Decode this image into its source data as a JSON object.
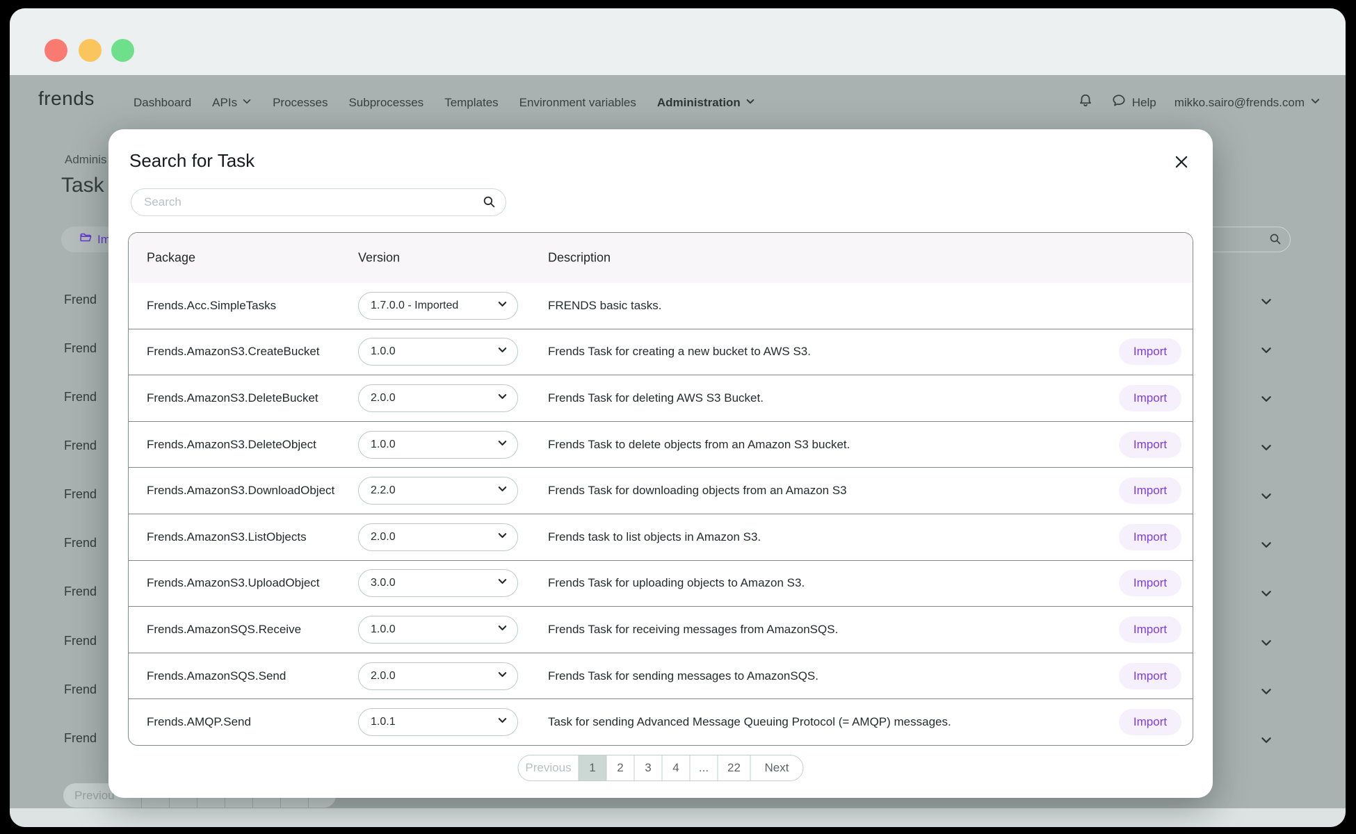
{
  "titlebar": {
    "traffic_lights": {
      "red": "#f97a70",
      "yellow": "#fbc55e",
      "green": "#6edf8a"
    }
  },
  "navbar": {
    "logo": "frends",
    "items": [
      "Dashboard",
      "APIs",
      "Processes",
      "Subprocesses",
      "Templates",
      "Environment variables",
      "Administration"
    ],
    "help": "Help",
    "email": "mikko.sairo@frends.com"
  },
  "background": {
    "breadcrumb": "Adminis",
    "heading": "Task",
    "import_task_button": "Im",
    "rows": [
      "Frend",
      "Frend",
      "Frend",
      "Frend",
      "Frend",
      "Frend",
      "Frend",
      "Frend",
      "Frend",
      "Frend"
    ],
    "pagination_previous": "Previou"
  },
  "modal": {
    "title": "Search for Task",
    "search_placeholder": "Search",
    "table": {
      "col_package": "Package",
      "col_version": "Version",
      "col_description": "Description",
      "rows": [
        {
          "package": "Frends.Acc.SimpleTasks",
          "version": "1.7.0.0 - Imported",
          "description": "FRENDS basic tasks."
        },
        {
          "package": "Frends.AmazonS3.CreateBucket",
          "version": "1.0.0",
          "description": "Frends Task for creating a new bucket to AWS S3.",
          "import": "Import"
        },
        {
          "package": "Frends.AmazonS3.DeleteBucket",
          "version": "2.0.0",
          "description": "Frends Task for deleting AWS S3 Bucket.",
          "import": "Import"
        },
        {
          "package": "Frends.AmazonS3.DeleteObject",
          "version": "1.0.0",
          "description": "Frends Task to delete objects from an Amazon S3 bucket.",
          "import": "Import"
        },
        {
          "package": "Frends.AmazonS3.DownloadObject",
          "version": "2.2.0",
          "description": "Frends Task for downloading objects from an Amazon S3",
          "import": "Import"
        },
        {
          "package": "Frends.AmazonS3.ListObjects",
          "version": "2.0.0",
          "description": "Frends task to list objects in Amazon S3.",
          "import": "Import"
        },
        {
          "package": "Frends.AmazonS3.UploadObject",
          "version": "3.0.0",
          "description": "Frends Task for uploading objects to Amazon S3.",
          "import": "Import"
        },
        {
          "package": "Frends.AmazonSQS.Receive",
          "version": "1.0.0",
          "description": "Frends Task for receiving messages from AmazonSQS.",
          "import": "Import"
        },
        {
          "package": "Frends.AmazonSQS.Send",
          "version": "2.0.0",
          "description": "Frends Task for sending messages to AmazonSQS.",
          "import": "Import"
        },
        {
          "package": "Frends.AMQP.Send",
          "version": "1.0.1",
          "description": "Task for sending Advanced Message Queuing Protocol (= AMQP) messages.",
          "import": "Import"
        }
      ]
    },
    "pagination": {
      "previous": "Previous",
      "pages": [
        "1",
        "2",
        "3",
        "4",
        "...",
        "22"
      ],
      "active_page": "1",
      "next": "Next"
    }
  },
  "colors": {
    "accent_purple": "#7c3aed",
    "import_button_bg": "#f5f0fc",
    "active_page_bg": "#ccd8d4",
    "dimmed_background": "#a9b2b1",
    "titlebar": "#edf0f1"
  }
}
